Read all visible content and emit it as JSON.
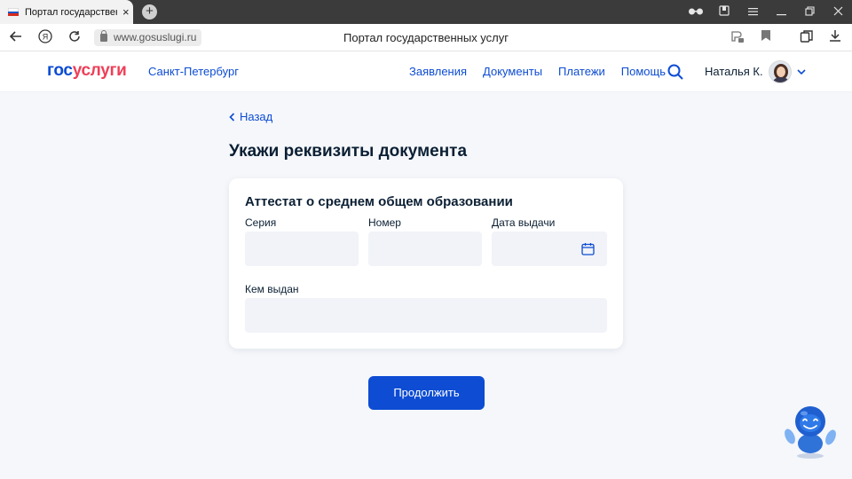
{
  "browser": {
    "tab_title": "Портал государственных",
    "tab_close": "×",
    "new_tab": "+",
    "url": "www.gosuslugi.ru",
    "page_title": "Портал государственных услуг",
    "icons": [
      "back-icon",
      "yandex-icon",
      "reload-icon",
      "lock-icon",
      "reader-icon",
      "bookmark-icon",
      "collections-icon",
      "download-icon",
      "glasses-icon",
      "extensions-icon",
      "menu-icon",
      "minimize-icon",
      "restore-icon",
      "close-icon"
    ]
  },
  "header": {
    "logo_part1": "гос",
    "logo_part2": "услуги",
    "region": "Санкт-Петербург",
    "menu": [
      "Заявления",
      "Документы",
      "Платежи",
      "Помощь"
    ],
    "user_name": "Наталья К."
  },
  "main": {
    "back_label": "Назад",
    "title": "Укажи реквизиты документа",
    "card": {
      "title": "Аттестат о среднем общем образовании",
      "fields": {
        "series_label": "Серия",
        "series_value": "",
        "number_label": "Номер",
        "number_value": "",
        "date_label": "Дата выдачи",
        "date_value": "",
        "issuer_label": "Кем выдан",
        "issuer_value": ""
      }
    },
    "continue_label": "Продолжить"
  },
  "colors": {
    "brand_blue": "#0d4cd3",
    "brand_red": "#ee3f58",
    "page_bg": "#f5f7fb",
    "field_bg": "#f1f3f8"
  }
}
